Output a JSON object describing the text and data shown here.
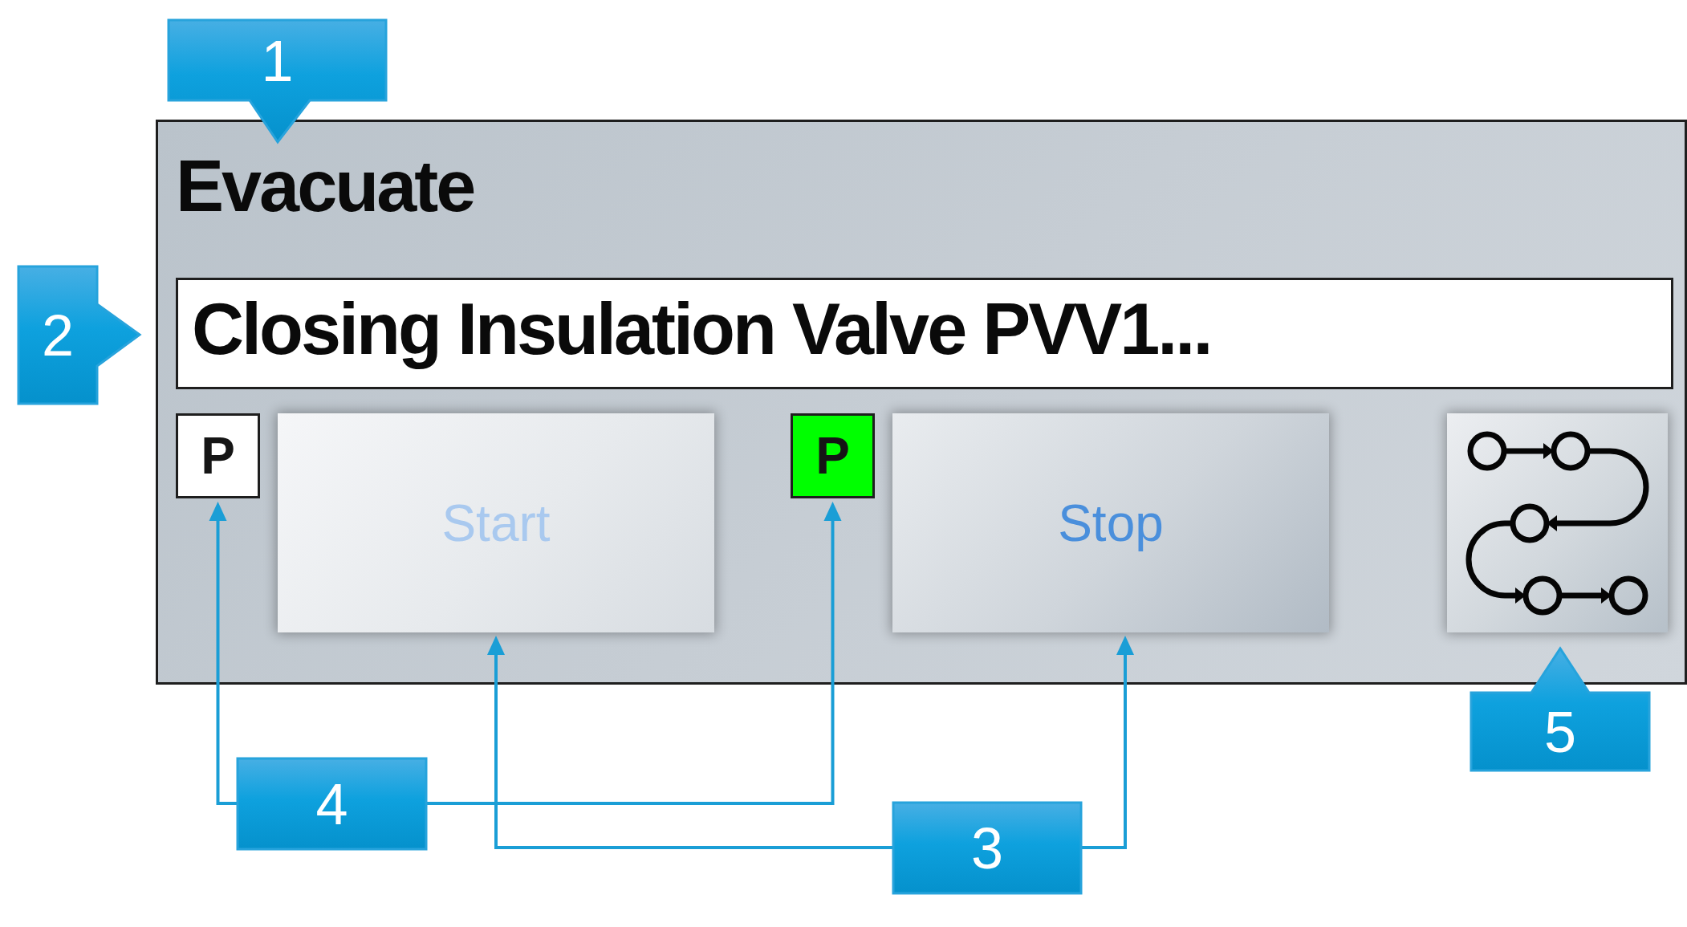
{
  "panel": {
    "title": "Evacuate",
    "status": "Closing Insulation Valve PVV1...",
    "controls": [
      {
        "kind": "toggle",
        "label": "P",
        "on": false
      },
      {
        "kind": "button",
        "label": "Start",
        "disabled": true
      },
      {
        "kind": "toggle",
        "label": "P",
        "on": true
      },
      {
        "kind": "button",
        "label": "Stop",
        "disabled": false
      },
      {
        "kind": "icon_button"
      }
    ]
  },
  "callouts": [
    {
      "label": "1"
    },
    {
      "label": "2"
    },
    {
      "label": "3"
    },
    {
      "label": "4"
    },
    {
      "label": "5"
    }
  ]
}
